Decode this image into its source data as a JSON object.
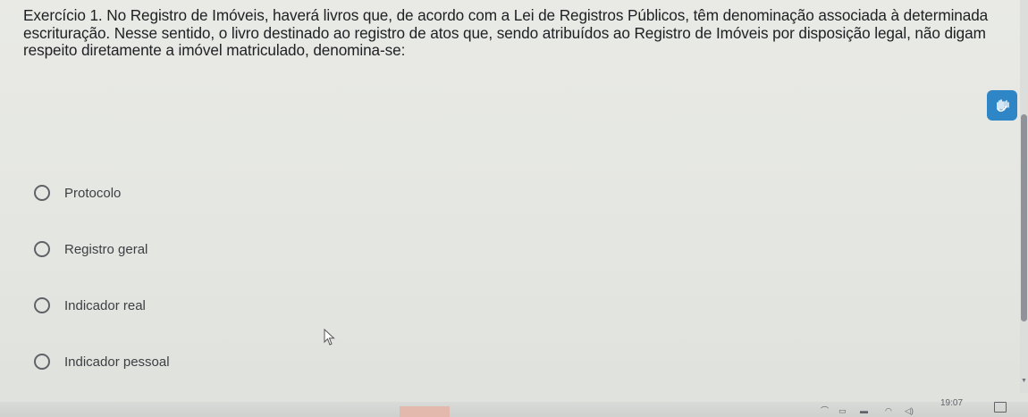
{
  "question": {
    "text": "Exercício 1. No Registro de Imóveis, haverá livros que, de acordo com a Lei de Registros Públicos, têm denominação associada à determinada escrituração. Nesse sentido, o livro destinado ao registro de atos que, sendo atribuídos ao Registro de Imóveis por disposição legal, não digam respeito diretamente a imóvel matriculado, denomina-se:"
  },
  "options": [
    {
      "label": "Protocolo"
    },
    {
      "label": "Registro geral"
    },
    {
      "label": "Indicador real"
    },
    {
      "label": "Indicador pessoal"
    }
  ],
  "accessibility_button": {
    "icon": "accessibility-hands-icon",
    "color": "#2f86c6"
  },
  "taskbar": {
    "clock": "19:07",
    "active_color": "#e3b9ae"
  }
}
